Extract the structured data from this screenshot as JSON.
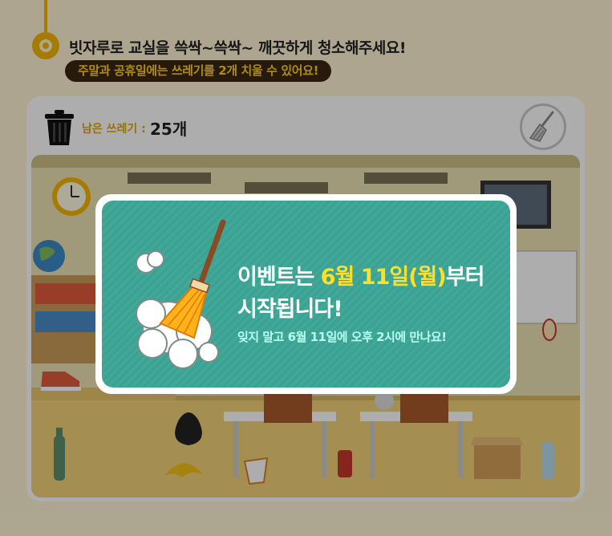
{
  "header": {
    "title": "빗자루로 교실을 쓱싹~쓱싹~ 깨끗하게 청소해주세요!",
    "subtitle": "주말과 공휴일에는 쓰레기를 2개 치울 수 있어요!"
  },
  "panel": {
    "remaining_label": "남은 쓰레기 :",
    "remaining_count": "25개",
    "icons": [
      "trash-can-icon",
      "broom-icon"
    ]
  },
  "scene": {
    "items": [
      "clock-icon",
      "globe-icon",
      "sneaker-icon",
      "bottle-icon",
      "banana-peel-icon",
      "trash-bag-icon",
      "cup-icon",
      "can-icon",
      "box-icon",
      "apple-core-icon",
      "crumpled-paper-icon"
    ]
  },
  "modal": {
    "line1_prefix": "이벤트는 ",
    "line1_highlight": "6월 11일(월)",
    "line1_suffix": "부터",
    "line2": "시작됩니다!",
    "sub": "잊지 말고 6월 11일에 오후 2시에 만나요!",
    "icons": [
      "broom-icon"
    ]
  },
  "colors": {
    "accent_yellow": "#f3b600",
    "modal_green": "#3aa393",
    "highlight": "#ffdf2a"
  }
}
